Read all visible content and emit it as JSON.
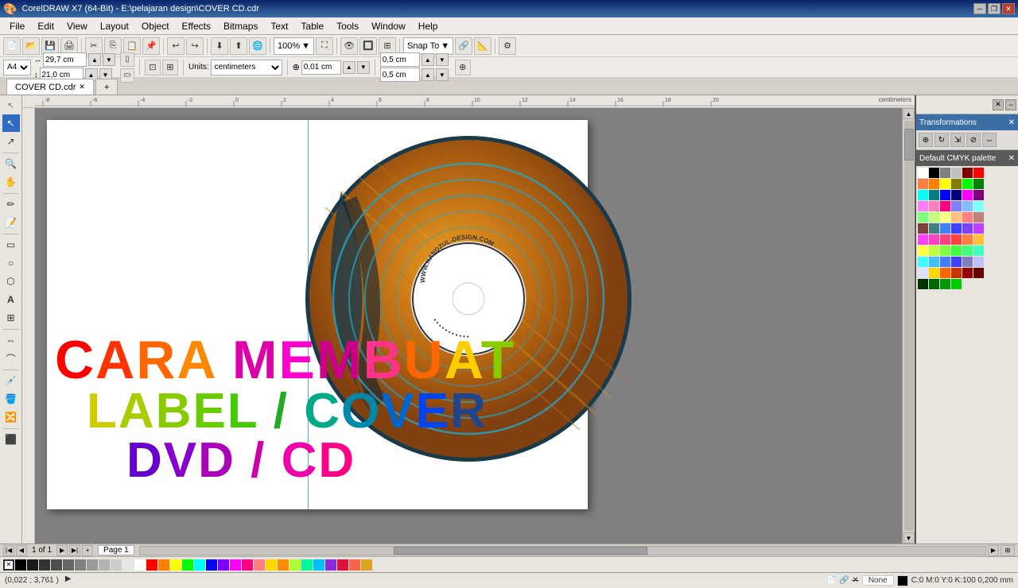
{
  "titlebar": {
    "title": "CorelDRAW X7 (64-Bit) - E:\\pelajaran design\\COVER CD.cdr",
    "icon": "coreldraw-icon",
    "btn_minimize": "─",
    "btn_restore": "❐",
    "btn_close": "✕"
  },
  "menubar": {
    "items": [
      "File",
      "Edit",
      "View",
      "Layout",
      "Object",
      "Effects",
      "Bitmaps",
      "Text",
      "Table",
      "Tools",
      "Window",
      "Help"
    ]
  },
  "toolbar1": {
    "zoom_value": "100%",
    "snap_to": "Snap To"
  },
  "toolbar2": {
    "paper_size": "A4",
    "width": "29,7 cm",
    "height": "21,0 cm",
    "units": "centimeters",
    "nudge": "0,01 cm",
    "nudge2": "0,5 cm",
    "nudge3": "0,5 cm"
  },
  "tab": {
    "label": "COVER CD.cdr",
    "add_label": "+"
  },
  "canvas": {
    "position": "(0,022 ; 3,761 )",
    "page_info": "1 of 1",
    "page_name": "Page 1",
    "fill": "None",
    "stroke_info": "C:0 M:0 Y:0 K:100  0,200 mm"
  },
  "text_line1": "CARA MEMBUAT",
  "text_line2": "LABEL/COVER",
  "text_line3": "DVD/CD",
  "cd_label": "WWW.KANGZUL-DESIGN.COM",
  "ruler": {
    "unit": "centimeters",
    "marks": [
      "-8",
      "-6",
      "-4",
      "-2",
      "0",
      "2",
      "4",
      "6",
      "8",
      "10",
      "12",
      "14",
      "16",
      "18",
      "20"
    ]
  },
  "transform_panel": {
    "title": "Transformations"
  },
  "status": {
    "position": "(0,022 ; 3,761 )",
    "page": "1 of 1",
    "page_name": "Page 1",
    "fill": "None",
    "stroke": "C:0 M:0 Y:0 K:100  0,200 mm"
  },
  "colors": {
    "swatches": [
      "#ffffff",
      "#000000",
      "#808080",
      "#c0c0c0",
      "#800000",
      "#ff0000",
      "#ff8040",
      "#ff8000",
      "#ffff00",
      "#808000",
      "#00ff00",
      "#008000",
      "#00ffff",
      "#008080",
      "#0000ff",
      "#000080",
      "#ff00ff",
      "#800080",
      "#ff80ff",
      "#ff80c0",
      "#ff0080",
      "#8080ff",
      "#80c0ff",
      "#80ffff",
      "#80ff80",
      "#c0ff80",
      "#ffff80",
      "#ffc080",
      "#ff8080",
      "#c08080",
      "#804040",
      "#408080",
      "#4080ff",
      "#4040ff",
      "#8040ff",
      "#c040ff",
      "#ff40ff",
      "#ff40c0",
      "#ff4080",
      "#ff4040",
      "#ff8040",
      "#ffc040",
      "#ffff40",
      "#c0ff40",
      "#80ff40",
      "#40ff40",
      "#40ff80",
      "#40ffc0",
      "#40ffff",
      "#40c0ff",
      "#4080ff",
      "#4040ff",
      "#8080c0",
      "#c0c0ff",
      "#e0e0ff",
      "#ffd700",
      "#ff6600",
      "#cc3300",
      "#990000",
      "#660000",
      "#003300",
      "#006600",
      "#009900",
      "#00cc00"
    ],
    "bottom": [
      "#000000",
      "#1a1a1a",
      "#333333",
      "#4d4d4d",
      "#666666",
      "#808080",
      "#999999",
      "#b3b3b3",
      "#cccccc",
      "#e6e6e6",
      "#ffffff",
      "#ff0000",
      "#ff8000",
      "#ffff00",
      "#00ff00",
      "#00ffff",
      "#0000ff",
      "#8000ff",
      "#ff00ff",
      "#ff0080",
      "#ff8080",
      "#ffd700",
      "#ff8c00",
      "#adff2f",
      "#00fa9a",
      "#00bfff",
      "#8a2be2",
      "#dc143c",
      "#ff6347",
      "#daa520"
    ]
  }
}
